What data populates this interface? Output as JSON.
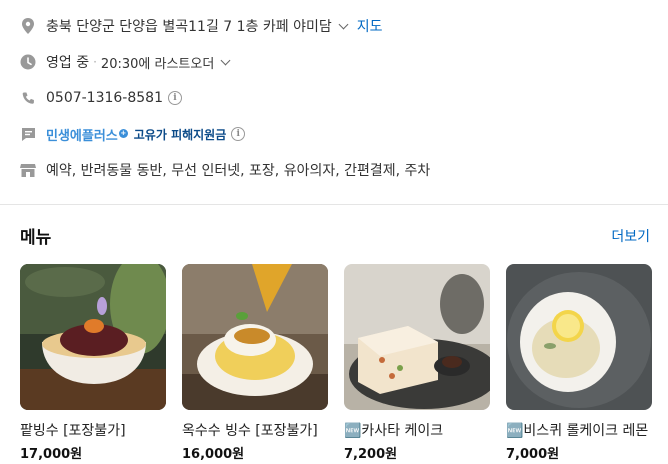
{
  "info": {
    "address": "충북 단양군 단양읍 별곡11길 7 1층 카페 야미담",
    "map_link": "지도",
    "status": "영업 중",
    "last_order": "20:30에 라스트오더",
    "phone": "0507-1316-8581",
    "minsaeng": "민생에플러스",
    "refund": "고유가 피해지원금",
    "amenities": "예약, 반려동물 동반, 무선 인터넷, 포장, 유아의자, 간편결제, 주차"
  },
  "menu": {
    "title": "메뉴",
    "more": "더보기",
    "items": [
      {
        "name": "팥빙수 [포장불가]",
        "price": "17,000원",
        "image": "red-bean-bingsu"
      },
      {
        "name": "옥수수 빙수 [포장불가]",
        "price": "16,000원",
        "image": "corn-bingsu"
      },
      {
        "name": "🆕카사타 케이크",
        "price": "7,200원",
        "image": "cassata-cake"
      },
      {
        "name": "🆕비스퀴 롤케이크 레몬",
        "price": "7,000원",
        "image": "biscuit-roll-cake"
      }
    ]
  },
  "colors": {
    "link": "#0068c3",
    "icon": "#999999",
    "minsaeng": "#3b8fd9",
    "refund": "#0b4a88"
  }
}
